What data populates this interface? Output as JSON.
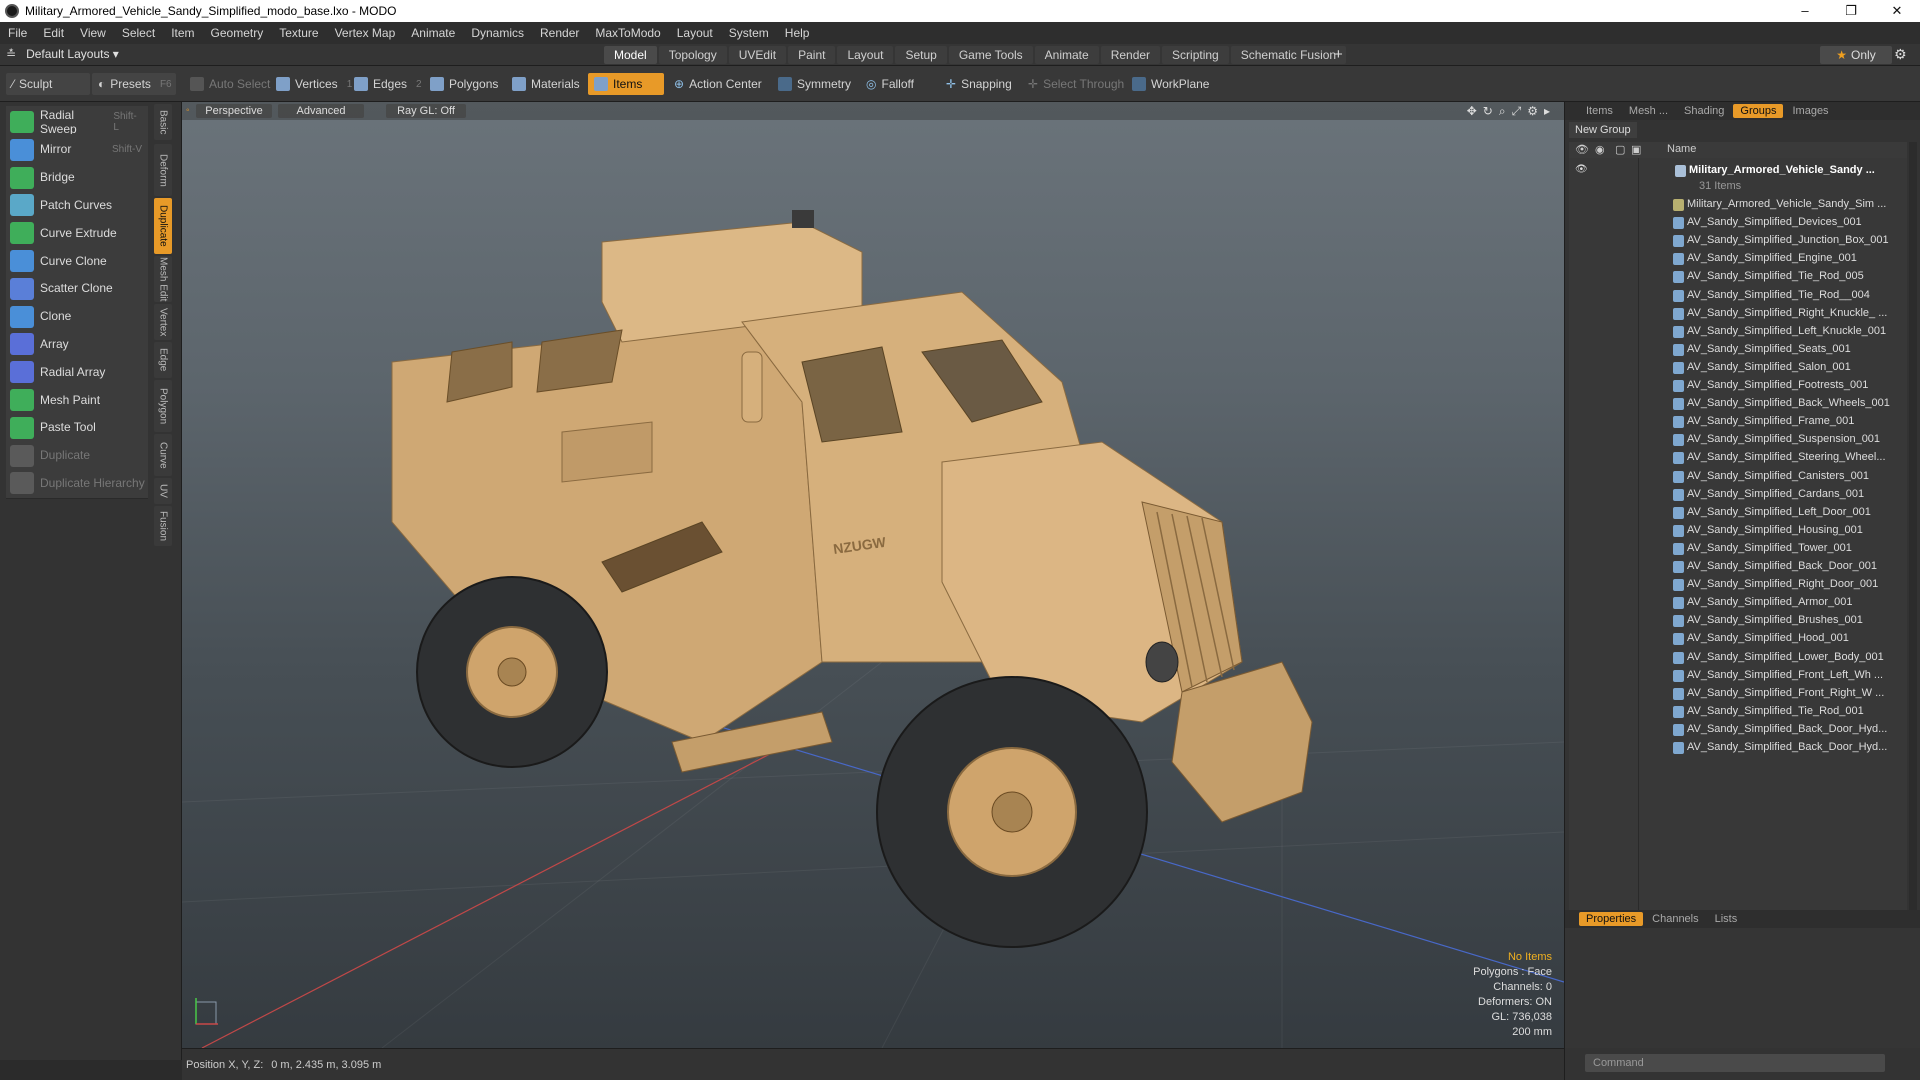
{
  "window": {
    "title": "Military_Armored_Vehicle_Sandy_Simplified_modo_base.lxo - MODO",
    "controls": [
      "–",
      "❐",
      "✕"
    ]
  },
  "menu": [
    "File",
    "Edit",
    "View",
    "Select",
    "Item",
    "Geometry",
    "Texture",
    "Vertex Map",
    "Animate",
    "Dynamics",
    "Render",
    "MaxToModo",
    "Layout",
    "System",
    "Help"
  ],
  "layoutbar": {
    "layout_label": "Default Layouts ▾",
    "tabs": [
      "Model",
      "Topology",
      "UVEdit",
      "Paint",
      "Layout",
      "Setup",
      "Game Tools",
      "Animate",
      "Render",
      "Scripting",
      "Schematic Fusion"
    ],
    "active_tab": "Model",
    "plus": "+",
    "only": "Only"
  },
  "toolbar": {
    "sculpt": "Sculpt",
    "presets": "Presets",
    "presets_key": "F6",
    "auto_select": "Auto Select",
    "vertices": "Vertices",
    "vertices_key": "1",
    "edges": "Edges",
    "edges_key": "2",
    "polygons": "Polygons",
    "materials": "Materials",
    "items": "Items",
    "action_center": "Action Center",
    "symmetry": "Symmetry",
    "falloff": "Falloff",
    "snapping": "Snapping",
    "select_through": "Select Through",
    "workplane": "WorkPlane"
  },
  "tools": [
    {
      "label": "Radial Sweep",
      "key": "Shift-L",
      "color": "#3fae5a"
    },
    {
      "label": "Mirror",
      "key": "Shift-V",
      "color": "#4a8fd8"
    },
    {
      "label": "Bridge",
      "key": "",
      "color": "#3fae5a"
    },
    {
      "label": "Patch Curves",
      "key": "",
      "color": "#5aa8c8"
    },
    {
      "label": "Curve Extrude",
      "key": "",
      "color": "#3fae5a"
    },
    {
      "label": "Curve Clone",
      "key": "",
      "color": "#4a8fd8"
    },
    {
      "label": "Scatter Clone",
      "key": "",
      "color": "#5a7fd8"
    },
    {
      "label": "Clone",
      "key": "",
      "color": "#4a8fd8"
    },
    {
      "label": "Array",
      "key": "",
      "color": "#5a6fd8"
    },
    {
      "label": "Radial Array",
      "key": "",
      "color": "#5a6fd8"
    },
    {
      "label": "Mesh Paint",
      "key": "",
      "color": "#3fae5a"
    },
    {
      "label": "Paste Tool",
      "key": "",
      "color": "#3fae5a"
    },
    {
      "label": "Duplicate",
      "key": "",
      "color": "#888888"
    },
    {
      "label": "Duplicate Hierarchy",
      "key": "",
      "color": "#888888"
    }
  ],
  "vtabs": [
    "Basic",
    "Deform",
    "Duplicate",
    "Mesh Edit",
    "Vertex",
    "Edge",
    "Polygon",
    "Curve",
    "UV",
    "Fusion"
  ],
  "viewport": {
    "perspective": "Perspective",
    "advanced": "Advanced",
    "raygl": "Ray GL: Off",
    "stats": {
      "selection": "No Items",
      "polygons": "Polygons : Face",
      "channels": "Channels: 0",
      "deformers": "Deformers: ON",
      "gl": "GL: 736,038",
      "scale": "200 mm"
    },
    "plate": "NZUGW"
  },
  "statusbar": {
    "label": "Position X, Y, Z:",
    "value": "0 m, 2.435 m, 3.095 m"
  },
  "rightpanel": {
    "tabs": [
      "Items",
      "Mesh ...",
      "Shading",
      "Groups",
      "Images"
    ],
    "active_tab": "Groups",
    "new_group": "New Group",
    "name_col": "Name",
    "group_name": "Military_Armored_Vehicle_Sandy ...",
    "group_count": "31 Items",
    "items": [
      "Military_Armored_Vehicle_Sandy_Sim ...",
      "AV_Sandy_Simplified_Devices_001",
      "AV_Sandy_Simplified_Junction_Box_001",
      "AV_Sandy_Simplified_Engine_001",
      "AV_Sandy_Simplified_Tie_Rod_005",
      "AV_Sandy_Simplified_Tie_Rod__004",
      "AV_Sandy_Simplified_Right_Knuckle_ ...",
      "AV_Sandy_Simplified_Left_Knuckle_001",
      "AV_Sandy_Simplified_Seats_001",
      "AV_Sandy_Simplified_Salon_001",
      "AV_Sandy_Simplified_Footrests_001",
      "AV_Sandy_Simplified_Back_Wheels_001",
      "AV_Sandy_Simplified_Frame_001",
      "AV_Sandy_Simplified_Suspension_001",
      "AV_Sandy_Simplified_Steering_Wheel...",
      "AV_Sandy_Simplified_Canisters_001",
      "AV_Sandy_Simplified_Cardans_001",
      "AV_Sandy_Simplified_Left_Door_001",
      "AV_Sandy_Simplified_Housing_001",
      "AV_Sandy_Simplified_Tower_001",
      "AV_Sandy_Simplified_Back_Door_001",
      "AV_Sandy_Simplified_Right_Door_001",
      "AV_Sandy_Simplified_Armor_001",
      "AV_Sandy_Simplified_Brushes_001",
      "AV_Sandy_Simplified_Hood_001",
      "AV_Sandy_Simplified_Lower_Body_001",
      "AV_Sandy_Simplified_Front_Left_Wh ...",
      "AV_Sandy_Simplified_Front_Right_W ...",
      "AV_Sandy_Simplified_Tie_Rod_001",
      "AV_Sandy_Simplified_Back_Door_Hyd...",
      "AV_Sandy_Simplified_Back_Door_Hyd..."
    ],
    "props_tabs": [
      "Properties",
      "Channels",
      "Lists"
    ],
    "props_active": "Properties",
    "command_placeholder": "Command"
  },
  "colors": {
    "accent": "#e89a28",
    "vehicle": "#d8b27c"
  }
}
